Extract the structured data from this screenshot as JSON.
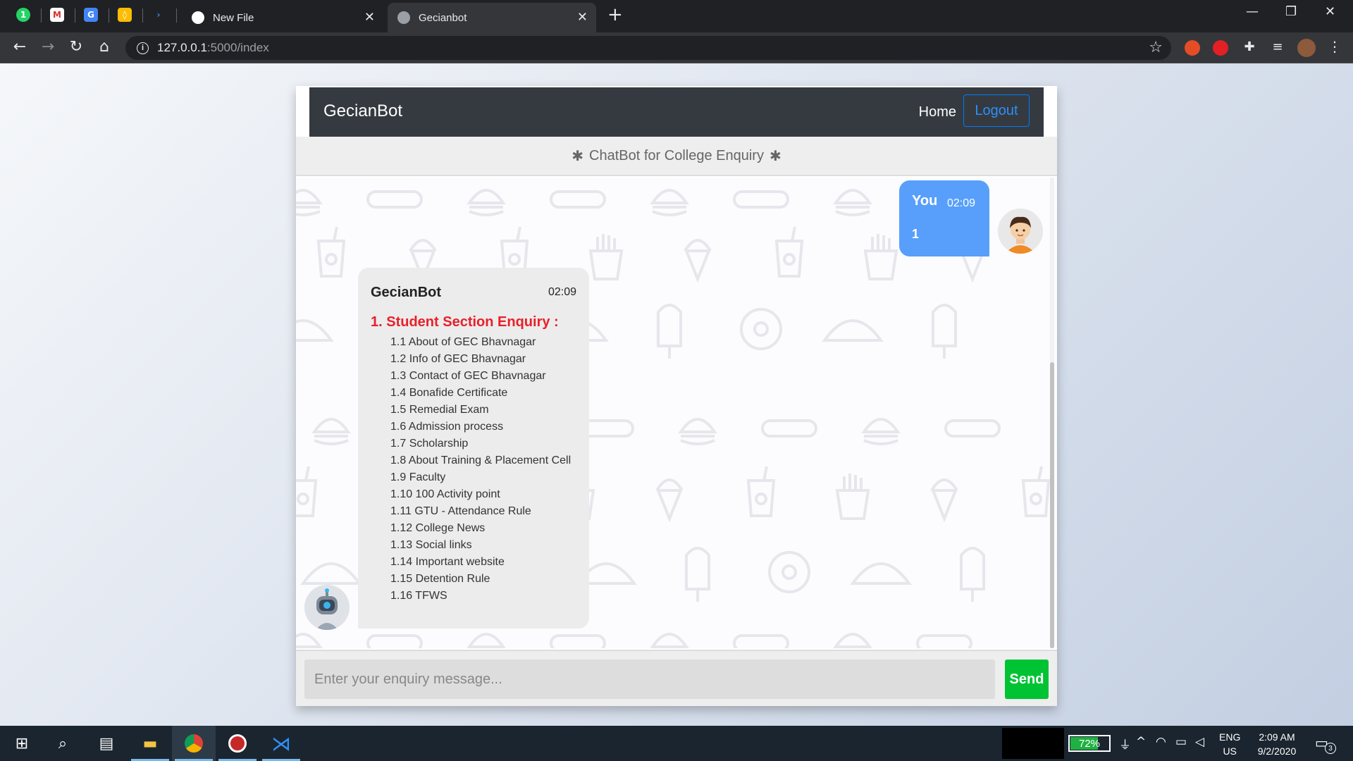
{
  "browser": {
    "tabs": [
      {
        "title": "New File",
        "icon": "github-icon"
      },
      {
        "title": "Gecianbot",
        "icon": "globe-icon",
        "active": true
      }
    ],
    "pinned_icons": [
      "whatsapp-icon",
      "gmail-icon",
      "google-translate-icon",
      "google-keep-icon",
      "vscode-remote-icon"
    ],
    "new_tab_label": "+",
    "close_glyph": "✕",
    "url_host": "127.0.0.1",
    "url_path": ":5000/index",
    "info_glyph": "i"
  },
  "navbar": {
    "brand": "GecianBot",
    "home": "Home",
    "logout": "Logout"
  },
  "chat": {
    "header_title": "ChatBot for College Enquiry",
    "header_icon": "bug-icon",
    "user_message": {
      "name": "You",
      "time": "02:09",
      "text": "1"
    },
    "bot_message": {
      "name": "GecianBot",
      "time": "02:09",
      "heading": "1. Student Section Enquiry :",
      "items": [
        "1.1 About of GEC Bhavnagar",
        "1.2 Info of GEC Bhavnagar",
        "1.3 Contact of GEC Bhavnagar",
        "1.4 Bonafide Certificate",
        "1.5 Remedial Exam",
        "1.6 Admission process",
        "1.7 Scholarship",
        "1.8 About Training & Placement Cell",
        "1.9 Faculty",
        "1.10 100 Activity point",
        "1.11 GTU - Attendance Rule",
        "1.12 College News",
        "1.13 Social links",
        "1.14 Important website",
        "1.15 Detention Rule",
        "1.16 TFWS"
      ]
    },
    "input_placeholder": "Enter your enquiry message...",
    "send_label": "Send"
  },
  "taskbar": {
    "battery": "72%",
    "battery_level": 0.72,
    "lang_line1": "ENG",
    "lang_line2": "US",
    "time": "2:09 AM",
    "date": "9/2/2020",
    "notification_count": "3"
  },
  "colors": {
    "navbar_bg": "#343a40",
    "user_bubble": "#579ffb",
    "bot_bubble": "#ececec",
    "heading_red": "#e8202a",
    "send_green": "#00c334",
    "logout_blue": "#007bff"
  }
}
